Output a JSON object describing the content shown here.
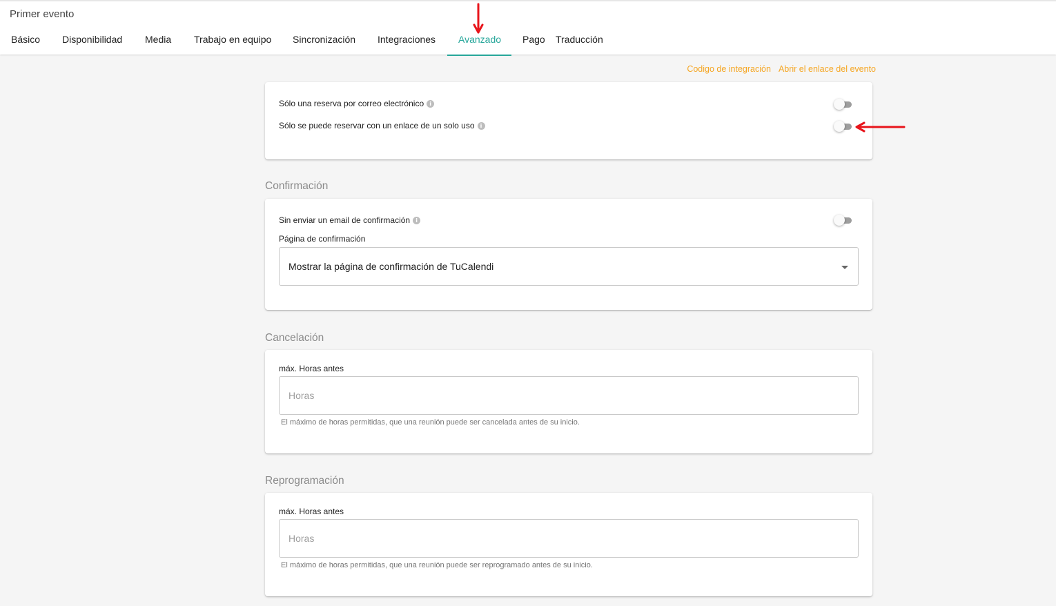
{
  "header": {
    "event_title": "Primer evento",
    "tabs": [
      {
        "label": "Básico"
      },
      {
        "label": "Disponibilidad"
      },
      {
        "label": "Media"
      },
      {
        "label": "Trabajo en equipo"
      },
      {
        "label": "Sincronización"
      },
      {
        "label": "Integraciones"
      },
      {
        "label": "Avanzado",
        "active": true
      },
      {
        "label": "Pago"
      },
      {
        "label": "Traducción"
      }
    ]
  },
  "links": {
    "integration_code": "Codigo de integración",
    "open_event_link": "Abrir el enlace del evento"
  },
  "booking": {
    "one_per_email": {
      "label": "Sólo una reserva por correo electrónico",
      "enabled": false
    },
    "single_use_link": {
      "label": "Sólo se puede reservar con un enlace de un solo uso",
      "enabled": false
    }
  },
  "confirmation": {
    "title": "Confirmación",
    "no_email": {
      "label": "Sin enviar un email de confirmación",
      "enabled": false
    },
    "page_label": "Página de confirmación",
    "page_value": "Mostrar la página de confirmación de TuCalendi"
  },
  "cancellation": {
    "title": "Cancelación",
    "field_label": "máx. Horas antes",
    "placeholder": "Horas",
    "value": "",
    "hint": "El máximo de horas permitidas, que una reunión puede ser cancelada antes de su inicio."
  },
  "rescheduling": {
    "title": "Reprogramación",
    "field_label": "máx. Horas antes",
    "placeholder": "Horas",
    "value": "",
    "hint": "El máximo de horas permitidas, que una reunión puede ser reprogramado antes de su inicio."
  },
  "colors": {
    "accent": "#26a69a",
    "link": "#f5a623",
    "annotation": "#e8141b"
  },
  "icons": {
    "info": "info-circle-icon",
    "dropdown": "caret-down-icon",
    "annotation": "red-arrow-icon"
  }
}
